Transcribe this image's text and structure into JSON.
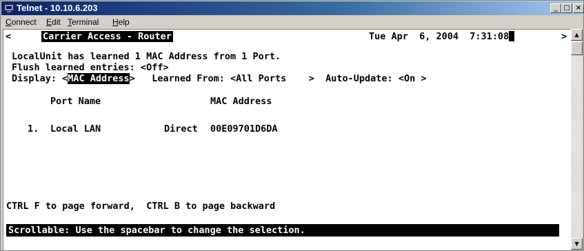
{
  "window": {
    "title": "Telnet - 10.10.6.203",
    "controls": {
      "minimize": "_",
      "maximize": "□",
      "close": "×"
    }
  },
  "menu": {
    "connect": {
      "mnemonic": "C",
      "rest": "onnect"
    },
    "edit": {
      "mnemonic": "E",
      "rest": "dit"
    },
    "terminal": {
      "mnemonic": "T",
      "rest": "erminal"
    },
    "help": {
      "mnemonic": "H",
      "rest": "elp"
    }
  },
  "screen": {
    "left_arrow": "<",
    "heading": "Carrier Access - Router",
    "datetime": "Tue Apr  6, 2004  7:31:08",
    "right_arrow": ">",
    "learned_line": "LocalUnit has learned 1 MAC Address from 1 Port.",
    "flush_line": "Flush learned entries: <Off>",
    "display_prefix": "Display: <",
    "display_value": "MAC Address",
    "display_suffix": ">   Learned From: <All Ports    >  Auto-Update: <On >",
    "column_port": "Port Name",
    "column_mac": "MAC Address",
    "rows": [
      {
        "index": "1.",
        "port": "Local LAN",
        "type": "Direct",
        "mac": "00E09701D6DA"
      }
    ],
    "paging_help": "CTRL F to page forward,  CTRL B to page backward",
    "status": "Scrollable: Use the spacebar to change the selection."
  },
  "icons": {
    "app": "telnet-icon",
    "scroll_up": "▲",
    "scroll_down": "▼"
  },
  "colors": {
    "titlebar_start": "#0a246a",
    "titlebar_end": "#a6caf0",
    "terminal_bg": "#ffffff",
    "terminal_fg": "#000000"
  }
}
